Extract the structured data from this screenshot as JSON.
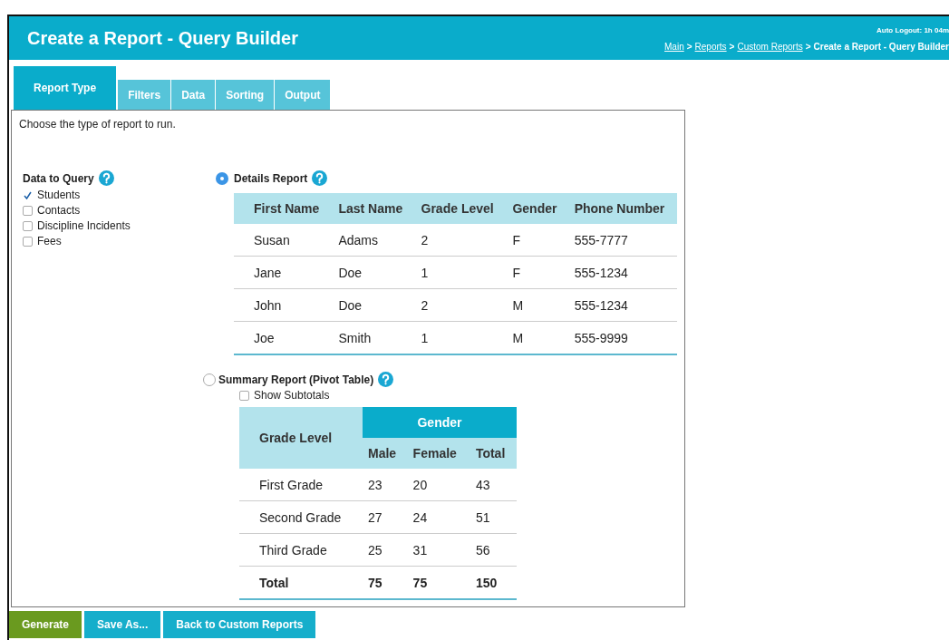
{
  "header": {
    "title": "Create a Report - Query Builder",
    "auto_logout": "Auto Logout: 1h 04m",
    "breadcrumb": [
      {
        "label": "Main",
        "kind": "link"
      },
      {
        "label": ">",
        "kind": "separator"
      },
      {
        "label": "Reports",
        "kind": "link"
      },
      {
        "label": ">",
        "kind": "separator"
      },
      {
        "label": "Custom Reports",
        "kind": "link"
      },
      {
        "label": ">",
        "kind": "separator"
      },
      {
        "label": "Create a Report - Query Builder",
        "kind": "current"
      }
    ]
  },
  "tabs": [
    {
      "label": "Report Type",
      "selected": true
    },
    {
      "label": "Filters",
      "selected": false
    },
    {
      "label": "Data",
      "selected": false
    },
    {
      "label": "Sorting",
      "selected": false
    },
    {
      "label": "Output",
      "selected": false
    }
  ],
  "instruction": "Choose the type of report to run.",
  "data_to_query": {
    "label": "Data to Query",
    "items": [
      {
        "label": "Students",
        "checked": true
      },
      {
        "label": "Contacts",
        "checked": false
      },
      {
        "label": "Discipline Incidents",
        "checked": false
      },
      {
        "label": "Fees",
        "checked": false
      }
    ]
  },
  "details_report": {
    "label": "Details Report",
    "selected": true,
    "columns": [
      "First Name",
      "Last Name",
      "Grade Level",
      "Gender",
      "Phone Number"
    ],
    "rows": [
      [
        "Susan",
        "Adams",
        "2",
        "F",
        "555-7777"
      ],
      [
        "Jane",
        "Doe",
        "1",
        "F",
        "555-1234"
      ],
      [
        "John",
        "Doe",
        "2",
        "M",
        "555-1234"
      ],
      [
        "Joe",
        "Smith",
        "1",
        "M",
        "555-9999"
      ]
    ]
  },
  "summary_report": {
    "label": "Summary Report (Pivot Table)",
    "selected": false,
    "show_subtotals": {
      "label": "Show Subtotals",
      "checked": false
    },
    "group_header": "Gender",
    "columns": [
      "Grade Level",
      "Male",
      "Female",
      "Total"
    ],
    "rows": [
      {
        "kind": "data",
        "cells": [
          "First Grade",
          "23",
          "20",
          "43"
        ]
      },
      {
        "kind": "data",
        "cells": [
          "Second Grade",
          "27",
          "24",
          "51"
        ]
      },
      {
        "kind": "data",
        "cells": [
          "Third Grade",
          "25",
          "31",
          "56"
        ]
      },
      {
        "kind": "total",
        "cells": [
          "Total",
          "75",
          "75",
          "150"
        ]
      }
    ]
  },
  "buttons": [
    {
      "label": "Generate",
      "kind": "primary"
    },
    {
      "label": "Save As...",
      "kind": "secondary"
    },
    {
      "label": "Back to Custom Reports",
      "kind": "secondary"
    }
  ]
}
